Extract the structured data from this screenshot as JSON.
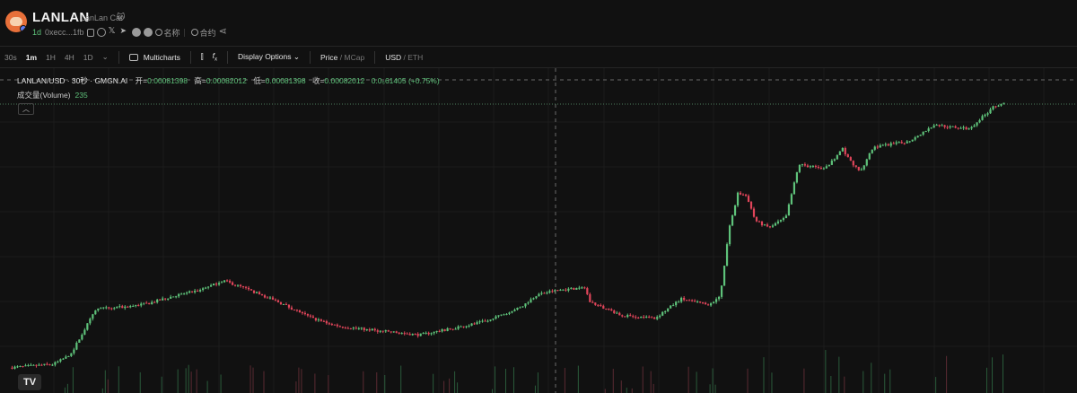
{
  "header": {
    "title": "LANLAN",
    "subtitle": "LanLan Cat",
    "age": "1d",
    "address": "0xecc...1fb",
    "name_link": "名称",
    "contract_link": "合约"
  },
  "toolbar": {
    "intervals": [
      "30s",
      "1m",
      "1H",
      "4H",
      "1D"
    ],
    "active_interval": "1m",
    "multicharts": "Multicharts",
    "display_options": "Display Options",
    "price": "Price",
    "mcap": "MCap",
    "usd": "USD",
    "eth": "ETH"
  },
  "legend": {
    "symbol": "LANLAN/USD · 30秒 · GMGN.AI",
    "open_label": "开=",
    "open": "0.00081398",
    "high_label": "高=",
    "high": "0.00082012",
    "low_label": "低=",
    "low": "0.00081398",
    "close_label": "收=",
    "close": "0.00082012",
    "change": "0.0₅61405 (+0.75%)",
    "volume_label": "成交量(Volume)",
    "volume": "235"
  },
  "colors": {
    "up": "#5ec27a",
    "down": "#e0455a",
    "background": "#111111"
  },
  "chart_data": {
    "type": "candlestick",
    "title": "LANLAN/USD · 30秒 · GMGN.AI",
    "price_path": [
      [
        0,
        0.000432
      ],
      [
        0.05,
        0.000438
      ],
      [
        0.07,
        0.000455
      ],
      [
        0.09,
        0.000512
      ],
      [
        0.1,
        0.000538
      ],
      [
        0.13,
        0.000541
      ],
      [
        0.16,
        0.000548
      ],
      [
        0.19,
        0.000562
      ],
      [
        0.22,
        0.000572
      ],
      [
        0.245,
        0.000589
      ],
      [
        0.27,
        0.000575
      ],
      [
        0.31,
        0.000549
      ],
      [
        0.35,
        0.000519
      ],
      [
        0.38,
        0.000506
      ],
      [
        0.42,
        0.000499
      ],
      [
        0.47,
        0.000491
      ],
      [
        0.51,
        0.000503
      ],
      [
        0.55,
        0.000517
      ],
      [
        0.59,
        0.000545
      ],
      [
        0.605,
        0.000564
      ],
      [
        0.63,
        0.000572
      ],
      [
        0.66,
        0.000576
      ],
      [
        0.665,
        0.000551
      ],
      [
        0.7,
        0.000526
      ],
      [
        0.74,
        0.000521
      ],
      [
        0.77,
        0.000556
      ],
      [
        0.8,
        0.000545
      ],
      [
        0.815,
        0.00056
      ],
      [
        0.825,
        0.000682
      ],
      [
        0.835,
        0.000746
      ],
      [
        0.845,
        0.000743
      ],
      [
        0.855,
        0.000697
      ],
      [
        0.87,
        0.000684
      ],
      [
        0.89,
        0.000702
      ],
      [
        0.905,
        0.000798
      ],
      [
        0.935,
        0.00079
      ],
      [
        0.955,
        0.000826
      ],
      [
        0.965,
        0.000802
      ],
      [
        0.975,
        0.000784
      ],
      [
        0.99,
        0.000829
      ],
      [
        1.03,
        0.000839
      ],
      [
        1.06,
        0.000869
      ],
      [
        1.1,
        0.000862
      ],
      [
        1.13,
        0.000904
      ],
      [
        1.14,
        0.00091
      ]
    ],
    "open": 0.00081398,
    "high": 0.00082012,
    "low": 0.00081398,
    "close": 0.00082012,
    "volume": 235
  }
}
